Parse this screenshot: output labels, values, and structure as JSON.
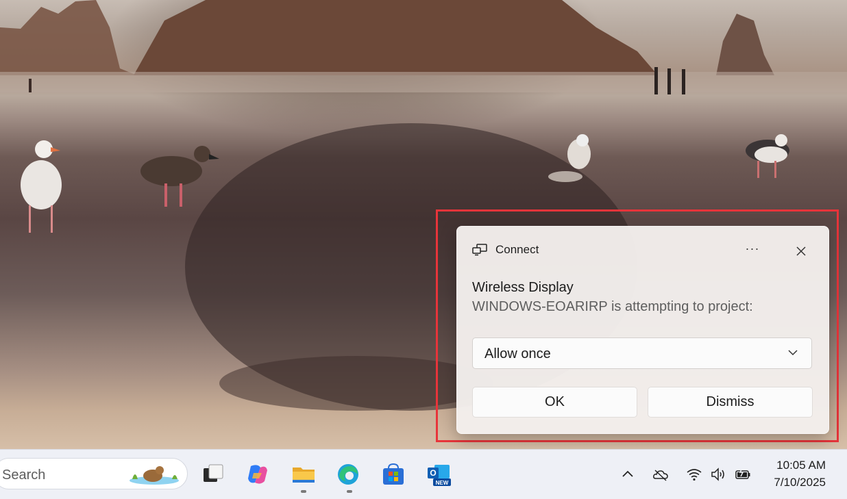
{
  "notification": {
    "app_name": "Connect",
    "more_label": "···",
    "title": "Wireless Display",
    "body": "WINDOWS-EOARIRP is attempting to project:",
    "dropdown_value": "Allow once",
    "ok_label": "OK",
    "dismiss_label": "Dismiss"
  },
  "taskbar": {
    "search_placeholder": "Search",
    "apps": [
      "task-view",
      "copilot",
      "file-explorer",
      "edge",
      "microsoft-store",
      "outlook-new"
    ],
    "outlook_badge": "NEW",
    "tray_icons": [
      "chevron-up-icon",
      "onedrive-icon",
      "wifi-icon",
      "volume-icon",
      "battery-icon"
    ],
    "time": "10:05 AM",
    "date": "7/10/2025"
  },
  "colors": {
    "highlight": "#e8343a",
    "taskbar_bg": "#eef0f6",
    "accent": "#0078d4"
  }
}
